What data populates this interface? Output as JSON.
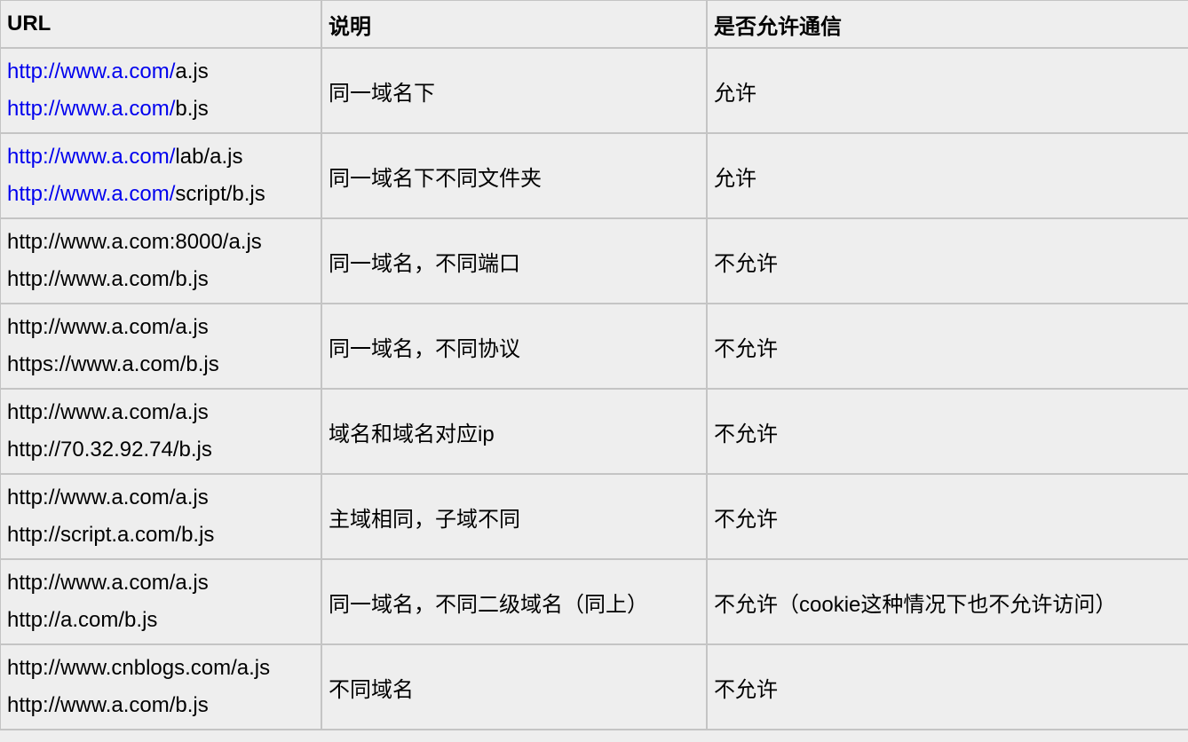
{
  "headers": [
    "URL",
    "说明",
    "是否允许通信"
  ],
  "rows": [
    {
      "urls": [
        {
          "link": "http://www.a.com/",
          "rest": "a.js"
        },
        {
          "link": "http://www.a.com/",
          "rest": "b.js"
        }
      ],
      "desc": "同一域名下",
      "allowed": "允许"
    },
    {
      "urls": [
        {
          "link": "http://www.a.com/",
          "rest": "lab/a.js"
        },
        {
          "link": "http://www.a.com/",
          "rest": "script/b.js"
        }
      ],
      "desc": "同一域名下不同文件夹",
      "allowed": "允许"
    },
    {
      "urls": [
        {
          "link": "",
          "rest": "http://www.a.com:8000/a.js"
        },
        {
          "link": "",
          "rest": "http://www.a.com/b.js"
        }
      ],
      "desc": "同一域名，不同端口",
      "allowed": "不允许"
    },
    {
      "urls": [
        {
          "link": "",
          "rest": "http://www.a.com/a.js"
        },
        {
          "link": "",
          "rest": "https://www.a.com/b.js"
        }
      ],
      "desc": "同一域名，不同协议",
      "allowed": "不允许"
    },
    {
      "urls": [
        {
          "link": "",
          "rest": "http://www.a.com/a.js"
        },
        {
          "link": "",
          "rest": "http://70.32.92.74/b.js"
        }
      ],
      "desc": "域名和域名对应ip",
      "allowed": "不允许"
    },
    {
      "urls": [
        {
          "link": "",
          "rest": "http://www.a.com/a.js"
        },
        {
          "link": "",
          "rest": "http://script.a.com/b.js"
        }
      ],
      "desc": "主域相同，子域不同",
      "allowed": "不允许"
    },
    {
      "urls": [
        {
          "link": "",
          "rest": "http://www.a.com/a.js"
        },
        {
          "link": "",
          "rest": "http://a.com/b.js"
        }
      ],
      "desc": "同一域名，不同二级域名（同上）",
      "allowed": "不允许（cookie这种情况下也不允许访问）"
    },
    {
      "urls": [
        {
          "link": "",
          "rest": "http://www.cnblogs.com/a.js"
        },
        {
          "link": "",
          "rest": "http://www.a.com/b.js"
        }
      ],
      "desc": "不同域名",
      "allowed": "不允许"
    }
  ]
}
